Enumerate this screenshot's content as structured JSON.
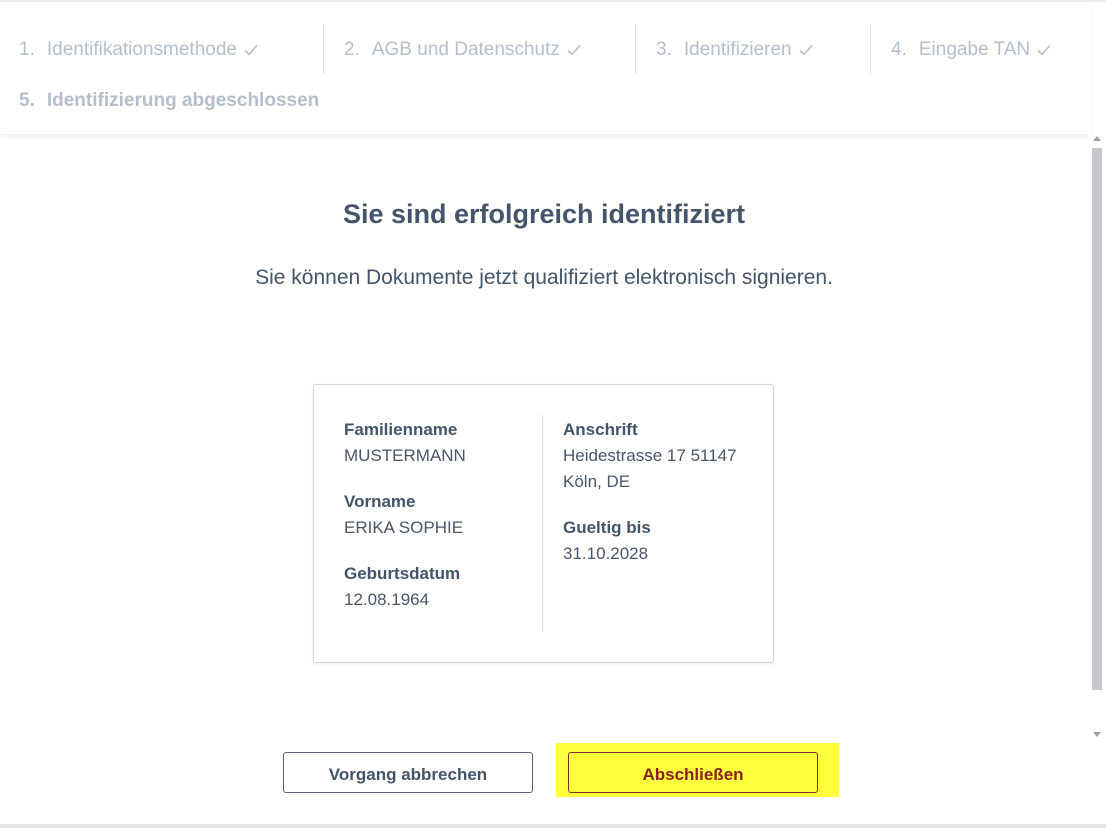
{
  "steps": [
    {
      "num": "1.",
      "label": "Identifikationsmethode",
      "done": true
    },
    {
      "num": "2.",
      "label": "AGB und Datenschutz",
      "done": true
    },
    {
      "num": "3.",
      "label": "Identifizieren",
      "done": true
    },
    {
      "num": "4.",
      "label": "Eingabe TAN",
      "done": true
    },
    {
      "num": "5.",
      "label": "Identifizierung abgeschlossen",
      "done": false
    }
  ],
  "main": {
    "title": "Sie sind erfolgreich identifiziert",
    "subtitle": "Sie können Dokumente jetzt qualifiziert elektronisch signieren."
  },
  "identity": {
    "surname": {
      "label": "Familienname",
      "value": "MUSTERMANN"
    },
    "firstname": {
      "label": "Vorname",
      "value": "ERIKA SOPHIE"
    },
    "birthdate": {
      "label": "Geburtsdatum",
      "value": "12.08.1964"
    },
    "address": {
      "label": "Anschrift",
      "line1": "Heidestrasse 17 51147",
      "line2": "Köln, DE"
    },
    "valid_until": {
      "label": "Gueltig bis",
      "value": "31.10.2028"
    }
  },
  "actions": {
    "cancel_label": "Vorgang abbrechen",
    "finish_label": "Abschließen"
  },
  "colors": {
    "step_text": "#b5bfcc",
    "heading": "#44546a",
    "highlight": "#ffff3b",
    "finish_text": "#8b1e1e"
  }
}
